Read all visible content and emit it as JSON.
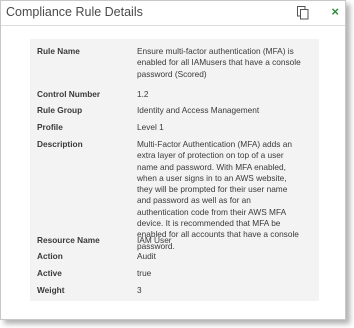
{
  "dialog": {
    "title": "Compliance Rule Details",
    "close_label": "×"
  },
  "rule": {
    "fields": [
      {
        "label": "Rule Name",
        "value": "Ensure multi-factor authentication (MFA) is enabled for all IAMusers that have a console password (Scored)"
      },
      {
        "label": "Control Number",
        "value": "1.2"
      },
      {
        "label": "Rule Group",
        "value": "Identity and Access Management"
      },
      {
        "label": "Profile",
        "value": "Level 1"
      },
      {
        "label": "Description",
        "value": "Multi-Factor Authentication (MFA) adds an extra layer of protection on top of a user name and password. With MFA enabled, when a user signs in to an AWS website, they will be prompted for their user name and password as well as for an authentication code from their AWS MFA device. It is recommended that MFA be enabled for all accounts that have a console password."
      },
      {
        "label": "Resource Name",
        "value": "IAM User"
      },
      {
        "label": "Action",
        "value": "Audit"
      },
      {
        "label": "Active",
        "value": "true"
      },
      {
        "label": "Weight",
        "value": "3"
      }
    ]
  },
  "icons": {
    "copy": "copy-icon",
    "close": "close-icon"
  },
  "colors": {
    "close_accent": "#2e8b3e",
    "panel_background": "#f3f3f3"
  }
}
